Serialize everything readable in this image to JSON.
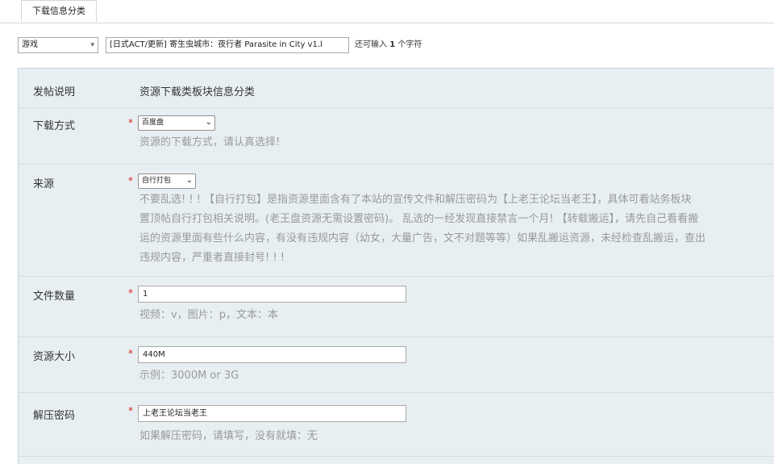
{
  "tab": {
    "label": "下载信息分类"
  },
  "title_row": {
    "type_select": "游戏",
    "title_value": "[日式ACT/更新] 寄生虫城市：夜行者 Parasite in City v1.l",
    "remain_prefix": "还可输入",
    "remain_count": "1",
    "remain_suffix": "个字符"
  },
  "form": {
    "notice": {
      "label": "发帖说明",
      "value": "资源下载类板块信息分类"
    },
    "download_method": {
      "label": "下载方式",
      "star": "*",
      "selected": "百度盘",
      "hint": "资源的下载方式，请认真选择!"
    },
    "source": {
      "label": "来源",
      "star": "*",
      "selected": "自行打包",
      "hint_lines": [
        "不要乱选! ! ! 【自行打包】是指资源里面含有了本站的宣传文件和解压密码为【上老王论坛当老王】，具体可看站务板块",
        "置顶帖自行打包相关说明。(老王盘资源无需设置密码)。 乱选的一经发现直接禁言一个月! 【转载搬运】，请先自己看看搬",
        "运的资源里面有些什么内容，有没有违规内容（幼女，大量广告，文不对题等等）如果乱搬运资源，未经检查乱搬运，查出",
        "违规内容，严重者直接封号! ! !"
      ]
    },
    "file_count": {
      "label": "文件数量",
      "star": "*",
      "value": "1",
      "hint": "视频：v，图片：p，文本：本"
    },
    "resource_size": {
      "label": "资源大小",
      "star": "*",
      "value": "440M",
      "hint": "示例：3000M or 3G"
    },
    "password": {
      "label": "解压密码",
      "star": "*",
      "value": "上老王论坛当老王",
      "hint": "如果解压密码，请填写，没有就填：无"
    }
  }
}
